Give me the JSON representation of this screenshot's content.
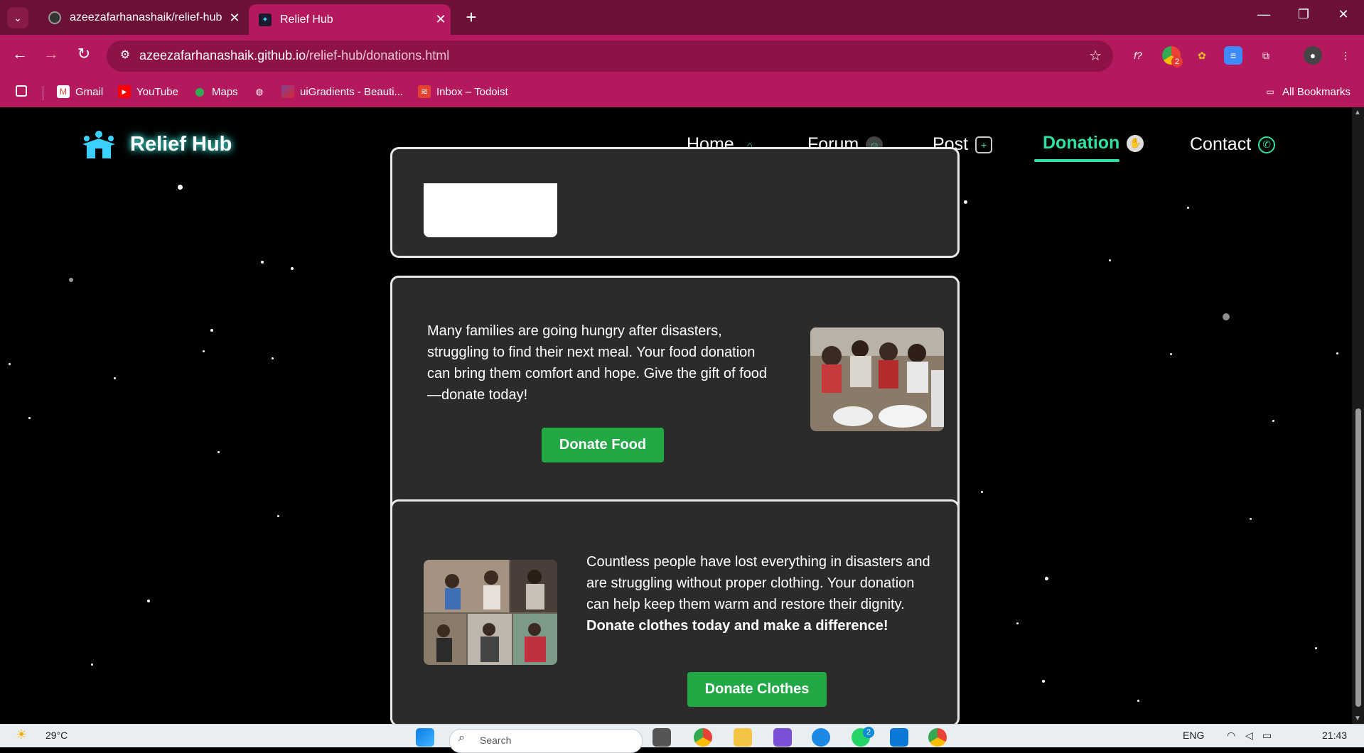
{
  "browser": {
    "tabs": [
      {
        "title": "azeezafarhanashaik/relief-hub",
        "active": false
      },
      {
        "title": "Relief Hub",
        "active": true
      }
    ],
    "url_host": "azeezafarhanashaik.github.io",
    "url_path": "/relief-hub/donations.html",
    "bookmarks": [
      "Gmail",
      "YouTube",
      "Maps",
      "uiGradients - Beauti...",
      "Inbox – Todoist"
    ],
    "all_bookmarks": "All Bookmarks",
    "extension_badge": "2"
  },
  "site": {
    "logo_text": "Relief Hub",
    "nav": [
      {
        "label": "Home",
        "icon": "house-icon"
      },
      {
        "label": "Forum",
        "icon": "forum-icon"
      },
      {
        "label": "Post",
        "icon": "post-add-icon"
      },
      {
        "label": "Donation",
        "icon": "donation-hand-icon",
        "active": true
      },
      {
        "label": "Contact",
        "icon": "phone-icon"
      }
    ]
  },
  "cards": {
    "food": {
      "text": "Many families are going hungry after disasters, struggling to find their next meal. Your food donation can bring them comfort and hope. Give the gift of food —donate today!",
      "button": "Donate Food"
    },
    "clothes": {
      "text": "Countless people have lost everything in disasters and are struggling without proper clothing. Your donation can help keep them warm and restore their dignity. ",
      "text_bold": "Donate clothes today and make a difference!",
      "button": "Donate Clothes"
    }
  },
  "taskbar": {
    "weather": "29°C",
    "search_placeholder": "Search",
    "language": "ENG",
    "time": "21:43",
    "badge": "2"
  },
  "colors": {
    "tab_bar": "#6b1036",
    "toolbar": "#b3195c",
    "accent_green": "#2fe0a2",
    "button_green": "#22a845",
    "card_bg": "#2b2b2b"
  }
}
